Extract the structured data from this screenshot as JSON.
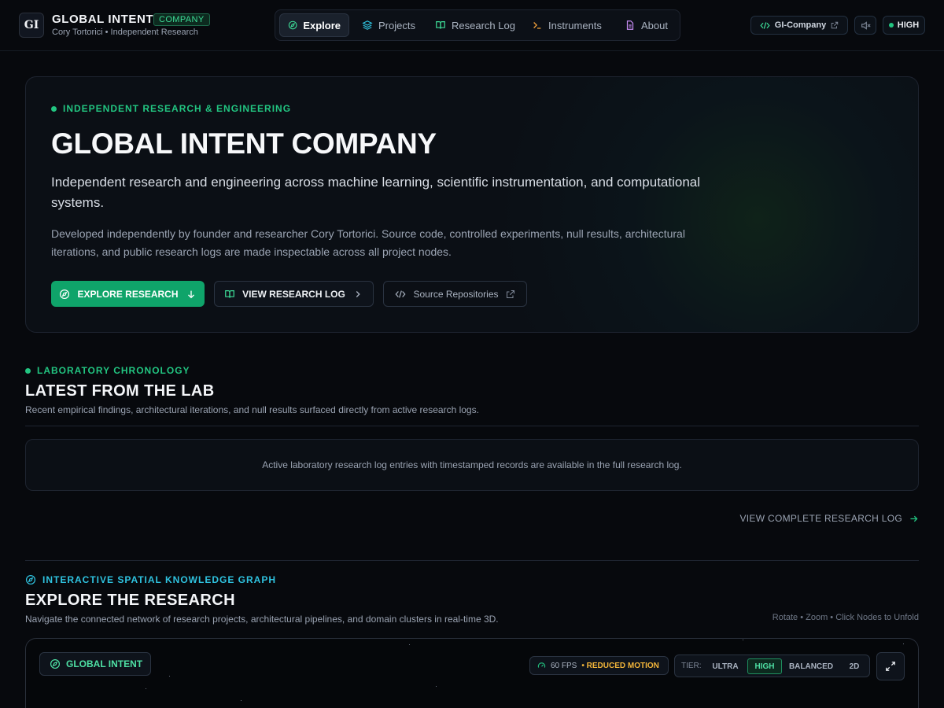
{
  "header": {
    "logo": "GI",
    "brand": "GLOBAL INTENT",
    "badge": "COMPANY",
    "subtitle": "Cory Tortorici • Independent Research",
    "nav": [
      {
        "label": "Explore",
        "icon": "compass-icon",
        "active": true
      },
      {
        "label": "Projects",
        "icon": "layers-icon",
        "active": false
      },
      {
        "label": "Research Log",
        "icon": "book-open-icon",
        "active": false
      },
      {
        "label": "Instruments",
        "icon": "terminal-icon",
        "active": false
      },
      {
        "label": "About",
        "icon": "file-text-icon",
        "active": false
      }
    ],
    "repo_label": "GI-Company",
    "quality": "HIGH"
  },
  "hero": {
    "eyebrow": "INDEPENDENT RESEARCH & ENGINEERING",
    "title": "GLOBAL INTENT COMPANY",
    "lead": "Independent research and engineering across machine learning, scientific instrumentation, and computational systems.",
    "body": "Developed independently by founder and researcher Cory Tortorici. Source code, controlled experiments, null results, architectural iterations, and public research logs are made inspectable across all project nodes.",
    "primary_label": "EXPLORE RESEARCH",
    "secondary_label": "VIEW RESEARCH LOG",
    "tertiary_label": "Source Repositories"
  },
  "lab": {
    "eyebrow": "LABORATORY CHRONOLOGY",
    "title": "LATEST FROM THE LAB",
    "subtitle": "Recent empirical findings, architectural iterations, and null results surfaced directly from active research logs.",
    "empty_message": "Active laboratory research log entries with timestamped records are available in the full research log.",
    "link_label": "VIEW COMPLETE RESEARCH LOG"
  },
  "graph": {
    "eyebrow": "INTERACTIVE SPATIAL KNOWLEDGE GRAPH",
    "title": "EXPLORE THE RESEARCH",
    "subtitle": "Navigate the connected network of research projects, architectural pipelines, and domain clusters in real-time 3D.",
    "hint": "Rotate • Zoom • Click Nodes to Unfold",
    "chip_label": "GLOBAL INTENT",
    "fps": "60 FPS",
    "motion": "• REDUCED MOTION",
    "tier_label": "TIER:",
    "tiers": [
      "ULTRA",
      "HIGH",
      "BALANCED",
      "2D"
    ],
    "tier_selected": "HIGH"
  },
  "colors": {
    "accent_green": "#22c581",
    "accent_cyan": "#2fc3e0",
    "warning": "#f2b53a",
    "background": "#07090d"
  }
}
